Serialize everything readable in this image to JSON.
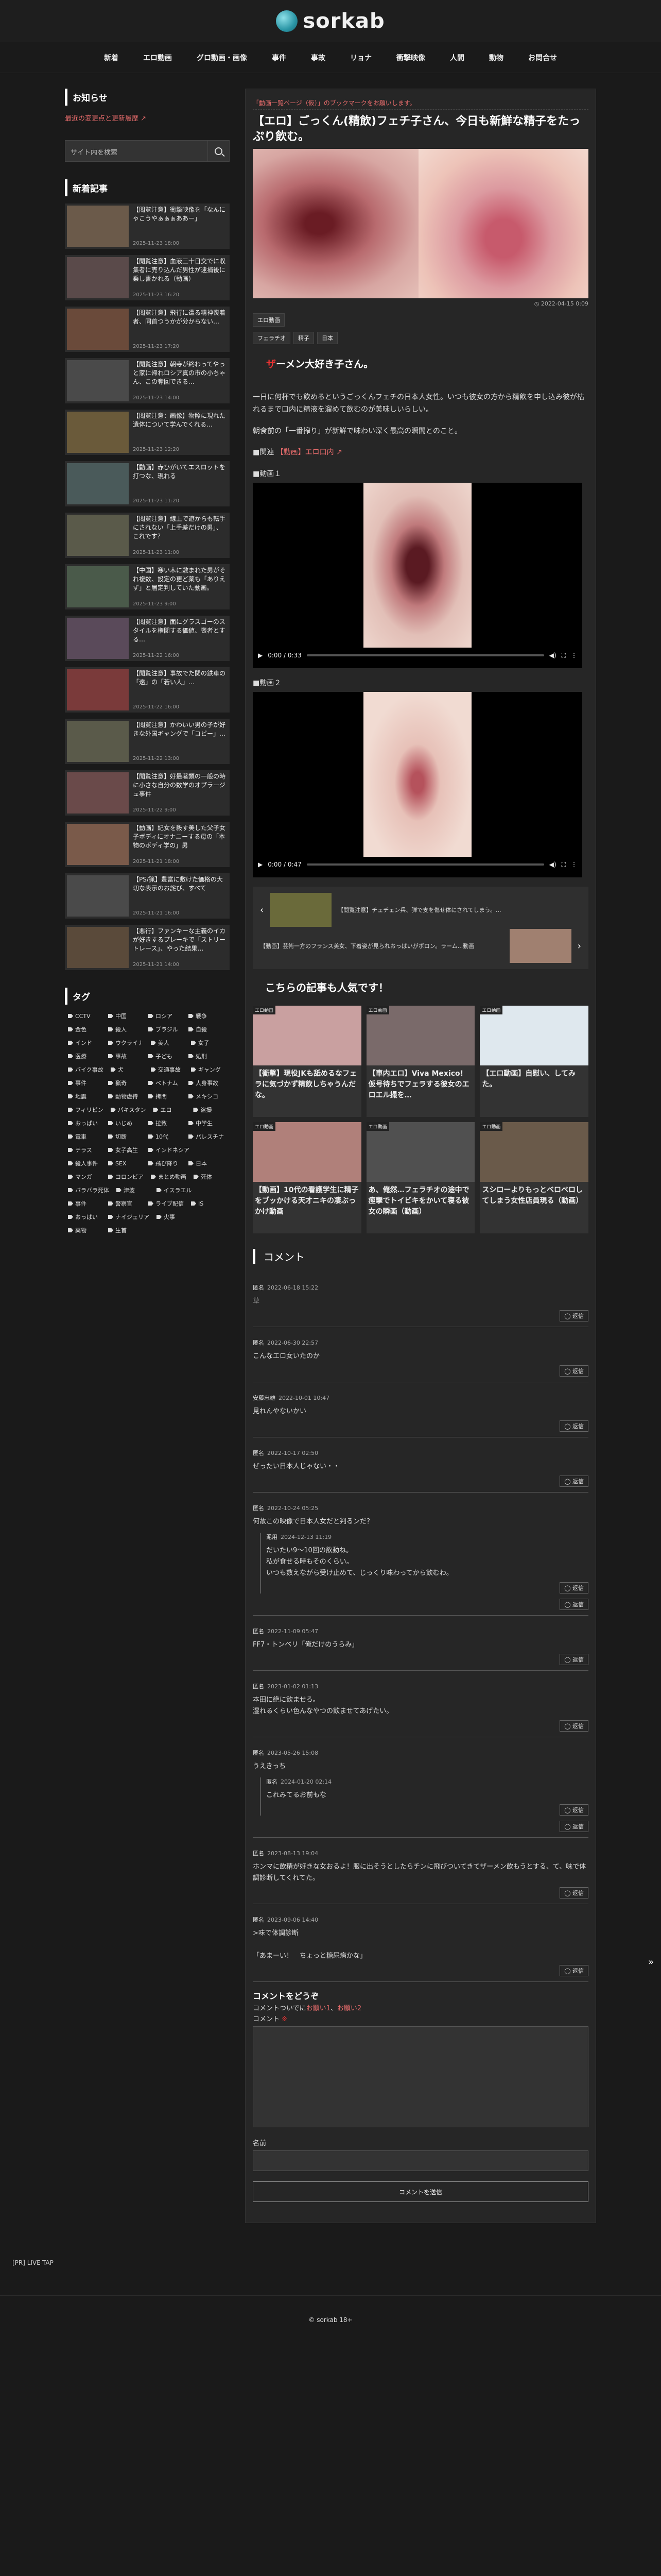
{
  "site": {
    "logo": "sorkab"
  },
  "nav": [
    "新着",
    "エロ動画",
    "グロ動画・画像",
    "事件",
    "事故",
    "リョナ",
    "衝撃映像",
    "人間",
    "動物",
    "お問合せ"
  ],
  "side": {
    "notice_title": "お知らせ",
    "notice_link": "最近の変更点と更新履歴 ↗",
    "search_placeholder": "サイト内を検索",
    "news_title": "新着記事",
    "news": [
      {
        "t": "【閲覧注意】衝撃映像を「なんにゃこうやぁぁぁああー」",
        "d": "2025-11-23 18:00",
        "c": "#6b5a4a"
      },
      {
        "t": "【閲覧注意】血液三十日交でに収集者に売り込んだ男性が逮捕後に乗し書かれる（動画）",
        "d": "2025-11-23 16:20",
        "c": "#5a4a4a"
      },
      {
        "t": "【閲覧注意】飛行に遭る精神喪着者、同首つうかが分からない…",
        "d": "2025-11-23 17:20",
        "c": "#6a4a3a"
      },
      {
        "t": "【閲覧注意】朝寺が終わってやっと家に帰れロシア真の市の小ちゃん、この奪回できる…",
        "d": "2025-11-23 14:00",
        "c": "#4a4a4a"
      },
      {
        "t": "【閲覧注意：画像】物照に現れた遺体について学んでくれる…",
        "d": "2025-11-23 12:20",
        "c": "#6a5a3a"
      },
      {
        "t": "【動画】赤ひがいてエスロットを打つな、現れる",
        "d": "2025-11-23 11:20",
        "c": "#4a5a5a"
      },
      {
        "t": "【閲覧注意】線上で遊からも転手にされない「上手差だけの男」、これです？",
        "d": "2025-11-23 11:00",
        "c": "#5a5a4a"
      },
      {
        "t": "【中国】寒い木に敷まれた男がそれ複数、設定の更ど薬も「ありえず」と届定判していた動画。",
        "d": "2025-11-23 9:00",
        "c": "#4a5a4a"
      },
      {
        "t": "【閲覧注意】面にグラスゴーのスタイルを権関する価値、喪者とする…",
        "d": "2025-11-22 16:00",
        "c": "#5a4a5a"
      },
      {
        "t": "【閲覧注意】事故でた関の鉄車の「遠」の「若い人」…",
        "d": "2025-11-22 16:00",
        "c": "#7a3a3a"
      },
      {
        "t": "【閲覧注意】かわいい男の子が好きな外国ギャングで「コピー」…",
        "d": "2025-11-22 13:00",
        "c": "#5a5a4a"
      },
      {
        "t": "【閲覧注意】好最著類の一般の時に小さな自分の数学のオプラージュ事件",
        "d": "2025-11-22 9:00",
        "c": "#6a4a4a"
      },
      {
        "t": "【動画】紀女を殺す美した父子女子ボディにオナニーする母の「本物のボディ学の」男",
        "d": "2025-11-21 18:00",
        "c": "#7a5a4a"
      },
      {
        "t": "【PS/猟】豊富に敷けた価格の大切な表示のお詫び、すべて",
        "d": "2025-11-21 16:00",
        "c": "#4a4a4a"
      },
      {
        "t": "【悪行】ファンキーな主義のイカが好きするプレーキで「ストリートレース」、やった結果…",
        "d": "2025-11-21 14:00",
        "c": "#5a4a3a"
      }
    ],
    "tags_title": "タグ",
    "tags": [
      "CCTV",
      "中国",
      "ロシア",
      "戦争",
      "金色",
      "殺人",
      "ブラジル",
      "自殺",
      "インド",
      "ウクライナ",
      "美人",
      "女子",
      "医療",
      "事故",
      "子ども",
      "処刑",
      "バイク事故",
      "犬",
      "交通事故",
      "ギャング",
      "事件",
      "猟奇",
      "ベトナム",
      "人身事故",
      "地震",
      "動物虐待",
      "拷問",
      "メキシコ",
      "フィリピン",
      "パキスタン",
      "エロ",
      "盗撮",
      "おっぱい",
      "いじめ",
      "拉致",
      "中学生",
      "電車",
      "切断",
      "10代",
      "パレスチナ",
      "テラス",
      "女子高生",
      "インドネシア",
      "殺人事件",
      "SEX",
      "飛び降り",
      "日本",
      "マンガ",
      "コロンビア",
      "まとめ動画",
      "死体",
      "バラバラ死体",
      "津波",
      "イスラエル",
      "事件",
      "警察官",
      "ライブ配信",
      "IS",
      "おっぱい",
      "ナイジェリア",
      "火事",
      "薬物",
      "生首"
    ],
    "pr": "[PR] LIVE-TAP"
  },
  "post": {
    "breadcrumb": "「動画一覧ページ（仮）」のブックマークをお願いします。",
    "title": "【エロ】ごっくん(精飲)フェチ子さん、今日も新鮮な精子をたっぷり飲む。",
    "date": "◷ 2022-04-15 0:09",
    "category": "エロ動画",
    "tags": [
      "フェラチオ",
      "精子",
      "日本"
    ],
    "lead_red": "ザ",
    "lead": "ーメン大好き子さん。",
    "p1": "一日に何杯でも飲めるというごっくんフェチの日本人女性。いつも彼女の方から精飲を申し込み彼が枯れるまで口内に精液を溜めて飲むのが美味しいらしい。",
    "p2": "朝食前の「一番搾り」が新鮮で味わい深く最高の瞬間とのこと。",
    "related_prefix": "■関連",
    "related_link": "【動画】エロ口内 ↗",
    "video1_label": "■動画１",
    "video1_time": "0:00 / 0:33",
    "video2_label": "■動画２",
    "video2_time": "0:00 / 0:47",
    "prev_title": "【閲覧注意】チェチェン兵、弾で支を傷せ体にされてしまう。...",
    "next_title": "【動画】芸術一方のフランス美女、下着姿が見られおっぱいがボロン。ラーム...動画",
    "popular_title": "こちらの記事も人気です！",
    "popular": [
      {
        "t": "【衝撃】現役JKも舐めるなフェラに気づかず精飲しちゃうんだな。",
        "badge": "エロ動画"
      },
      {
        "t": "【車内エロ】Viva Mexico! 仮号待ちでフェラする彼女のエロエル撮を…",
        "badge": "エロ動画"
      },
      {
        "t": "【エロ動画】自慰い、してみた。",
        "badge": "エロ動画"
      },
      {
        "t": "【動画】10代の看護学生に精子をブッかける天才ニキの凄ぶっかけ動画",
        "badge": "エロ動画"
      },
      {
        "t": "あ、俺然…フェラチオの途中で痙攣でトイビキをかいて寝る彼女の瞬画（動画）",
        "badge": "エロ動画"
      },
      {
        "t": "スシローよりもっとベロベロしてしまう女性店員現る（動画）",
        "badge": "エロ動画"
      }
    ]
  },
  "comments": {
    "title": "コメント",
    "reply_label": "返信",
    "items": [
      {
        "n": "匿名",
        "d": "2022-06-18 15:22",
        "b": "草",
        "nested": []
      },
      {
        "n": "匿名",
        "d": "2022-06-30 22:57",
        "b": "こんなエロ女いたのか",
        "nested": []
      },
      {
        "n": "安藤忠雄",
        "d": "2022-10-01 10:47",
        "b": "見れんやないかい",
        "nested": []
      },
      {
        "n": "匿名",
        "d": "2022-10-17 02:50",
        "b": "ぜったい日本人じゃない・・",
        "nested": []
      },
      {
        "n": "匿名",
        "d": "2022-10-24 05:25",
        "b": "何故この映像で日本人女だと判るンだ？",
        "nested": [
          {
            "n": "泥用",
            "d": "2024-12-13 11:19",
            "b": "だいたい9～10回の飲動ね。\n私が食せる時もそのくらい。\nいつも数えながら受け止めて、じっくり味わってから飲むわ。"
          }
        ]
      },
      {
        "n": "匿名",
        "d": "2022-11-09 05:47",
        "b": "FF7・トンベリ「俺だけのうらみ」",
        "nested": []
      },
      {
        "n": "匿名",
        "d": "2023-01-02 01:13",
        "b": "本田に絶に飲ませろ。\n湿れるくらい色んなやつの飲ませてあげたい。",
        "nested": []
      },
      {
        "n": "匿名",
        "d": "2023-05-26 15:08",
        "b": "うえきっち",
        "nested": [
          {
            "n": "匿名",
            "d": "2024-01-20 02:14",
            "b": "これみてるお前もな"
          }
        ]
      },
      {
        "n": "匿名",
        "d": "2023-08-13 19:04",
        "b": "ホンマに飲精が好きな女おるよ！服に出そうとしたらチンに飛びついてきてザーメン飲もうとする、て、味で体調診断してくれてた。",
        "nested": []
      },
      {
        "n": "匿名",
        "d": "2023-09-06 14:40",
        "b": ">味で体調診断\n\n「あまーい！　ちょっと糖尿病かな」",
        "nested": []
      }
    ],
    "form_title": "コメントをどうぞ",
    "form_note": "コメントついでに",
    "form_note_link1": "お願い1",
    "form_note_link2": "お願い2",
    "form_comment_label": "コメント",
    "form_required": "※",
    "form_name_label": "名前",
    "form_submit": "コメントを送信"
  },
  "footer": "© sorkab 18+"
}
